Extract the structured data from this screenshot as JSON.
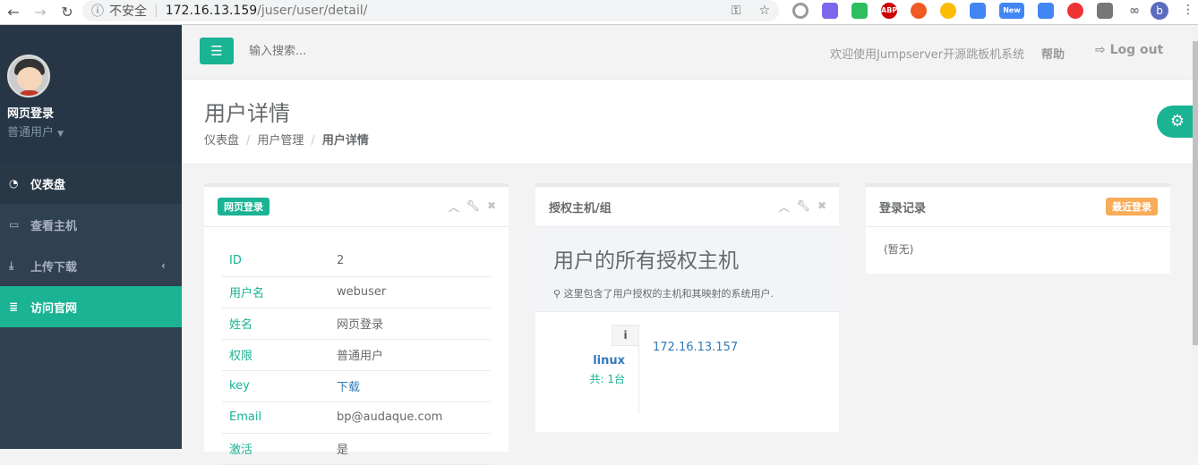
{
  "browser": {
    "security": "不安全",
    "host": "172.16.13.159",
    "path": "/juser/user/detail/",
    "profile_initial": "b",
    "ext_new": "New",
    "ext_abp": "ABP"
  },
  "sidebar": {
    "user_name": "网页登录",
    "user_role": "普通用户",
    "items": [
      {
        "label": "仪表盘"
      },
      {
        "label": "查看主机"
      },
      {
        "label": "上传下载"
      },
      {
        "label": "访问官网"
      }
    ]
  },
  "topbar": {
    "search_placeholder": "输入搜索...",
    "welcome": "欢迎使用Jumpserver开源跳板机系统",
    "help": "帮助",
    "logout": "Log out"
  },
  "header": {
    "title": "用户详情",
    "breadcrumb": [
      "仪表盘",
      "用户管理",
      "用户详情"
    ]
  },
  "user_panel": {
    "badge": "网页登录",
    "rows": [
      {
        "key": "ID",
        "value": "2"
      },
      {
        "key": "用户名",
        "value": "webuser"
      },
      {
        "key": "姓名",
        "value": "网页登录"
      },
      {
        "key": "权限",
        "value": "普通用户"
      },
      {
        "key": "key",
        "value": "下载"
      },
      {
        "key": "Email",
        "value": "bp@audaque.com"
      },
      {
        "key": "激活",
        "value": "是"
      }
    ]
  },
  "hosts_panel": {
    "title": "授权主机/组",
    "heading": "用户的所有授权主机",
    "desc": "这里包含了用户授权的主机和其映射的系统用户.",
    "group": "linux",
    "count": "共: 1台",
    "hosts": [
      "172.16.13.157"
    ]
  },
  "login_panel": {
    "title": "登录记录",
    "badge": "最近登录",
    "empty": "(暂无)"
  },
  "colors": {
    "accent": "#1ab394",
    "sidebar": "#2f4050",
    "warning": "#f8ac59"
  }
}
